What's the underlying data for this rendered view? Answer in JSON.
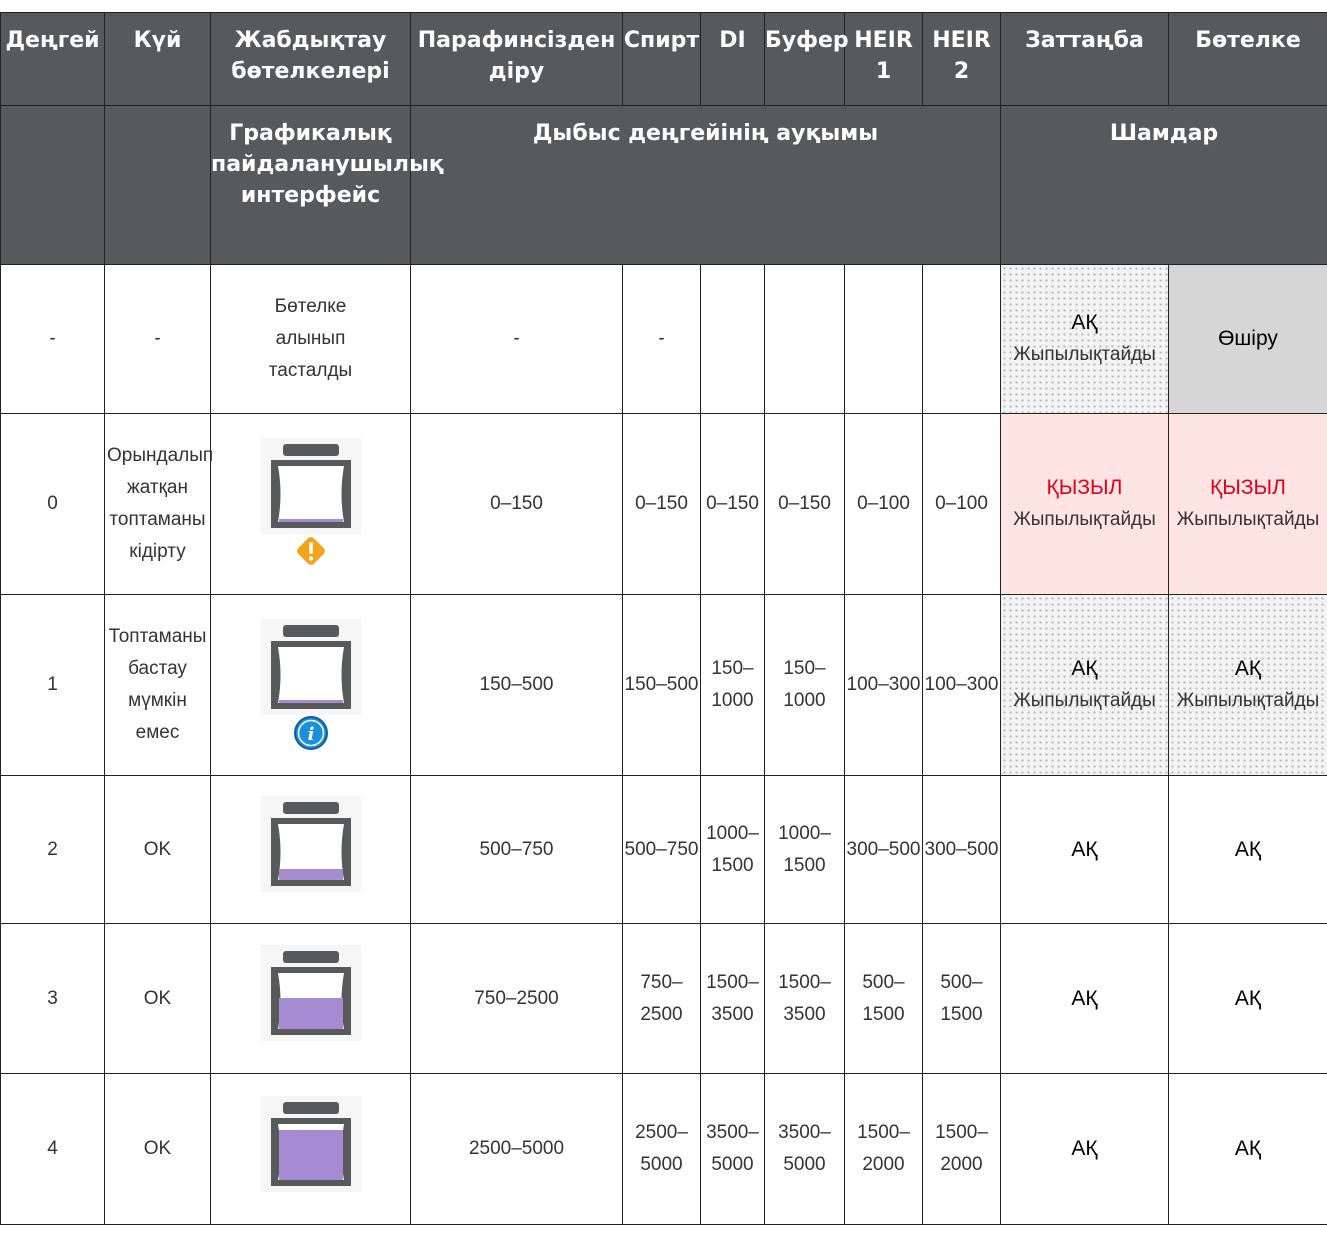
{
  "headers": {
    "level": "Деңгей",
    "state": "Күй",
    "bottles": "Жабдықтау бөтелкелері",
    "paraffin": "Парафинсізден діру",
    "alcohol": "Спирт",
    "di": "DI",
    "buffer": "Буфер",
    "heir1": "HEIR 1",
    "heir2": "HEIR 2",
    "waste": "Заттаңба",
    "bottle": "Бөтелке"
  },
  "subheaders": {
    "gui": "Графикалық пайдаланушылық интерфейс",
    "range": "Дыбыс деңгейінің ауқымы",
    "lamps": "Шамдар"
  },
  "rows": [
    {
      "level": "-",
      "state": "-",
      "gui_text": "Бөтелке алынып тасталды",
      "gui_icon": "none",
      "paraffin": "-",
      "alcohol": "-",
      "di": "",
      "buffer": "",
      "heir1": "",
      "heir2": "",
      "waste_color": "АҚ",
      "waste_mode": "Жыпылықтайды",
      "waste_style": "flash-white",
      "bottle_color": "Өшіру",
      "bottle_mode": "",
      "bottle_style": "off",
      "fill": 0
    },
    {
      "level": "0",
      "state": "Орындалып жатқан топтаманы кідірту",
      "gui_text": "",
      "gui_icon": "warning-icon",
      "paraffin": "0–150",
      "alcohol": "0–150",
      "di": "0–150",
      "buffer": "0–150",
      "heir1": "0–100",
      "heir2": "0–100",
      "waste_color": "ҚЫЗЫЛ",
      "waste_mode": "Жыпылықтайды",
      "waste_style": "flash-red",
      "bottle_color": "ҚЫЗЫЛ",
      "bottle_mode": "Жыпылықтайды",
      "bottle_style": "flash-red",
      "fill": 0.05
    },
    {
      "level": "1",
      "state": "Топтаманы бастау мүмкін емес",
      "gui_text": "",
      "gui_icon": "info-icon",
      "paraffin": "150–500",
      "alcohol": "150–500",
      "di": "150–1000",
      "buffer": "150–1000",
      "heir1": "100–300",
      "heir2": "100–300",
      "waste_color": "АҚ",
      "waste_mode": "Жыпылықтайды",
      "waste_style": "flash-white",
      "bottle_color": "АҚ",
      "bottle_mode": "Жыпылықтайды",
      "bottle_style": "flash-white",
      "fill": 0.05
    },
    {
      "level": "2",
      "state": "OK",
      "gui_text": "",
      "gui_icon": "none",
      "paraffin": "500–750",
      "alcohol": "500–750",
      "di": "1000–1500",
      "buffer": "1000–1500",
      "heir1": "300–500",
      "heir2": "300–500",
      "waste_color": "АҚ",
      "waste_mode": "",
      "waste_style": "blank",
      "bottle_color": "АҚ",
      "bottle_mode": "",
      "bottle_style": "blank",
      "fill": 0.2
    },
    {
      "level": "3",
      "state": "OK",
      "gui_text": "",
      "gui_icon": "none",
      "paraffin": "750–2500",
      "alcohol": "750–2500",
      "di": "1500–3500",
      "buffer": "1500–3500",
      "heir1": "500–1500",
      "heir2": "500–1500",
      "waste_color": "АҚ",
      "waste_mode": "",
      "waste_style": "blank",
      "bottle_color": "АҚ",
      "bottle_mode": "",
      "bottle_style": "blank",
      "fill": 0.55
    },
    {
      "level": "4",
      "state": "OK",
      "gui_text": "",
      "gui_icon": "none",
      "paraffin": "2500–5000",
      "alcohol": "2500–5000",
      "di": "3500–5000",
      "buffer": "3500–5000",
      "heir1": "1500–2000",
      "heir2": "1500–2000",
      "waste_color": "АҚ",
      "waste_mode": "",
      "waste_style": "blank",
      "bottle_color": "АҚ",
      "bottle_mode": "",
      "bottle_style": "blank",
      "fill": 0.9
    }
  ],
  "colors": {
    "header_bg": "#58595b",
    "liquid": "#a58bd1",
    "bottle": "#58595b",
    "red": "#e2001a",
    "warning": "#f7a21b",
    "info": "#1b8fd9"
  }
}
